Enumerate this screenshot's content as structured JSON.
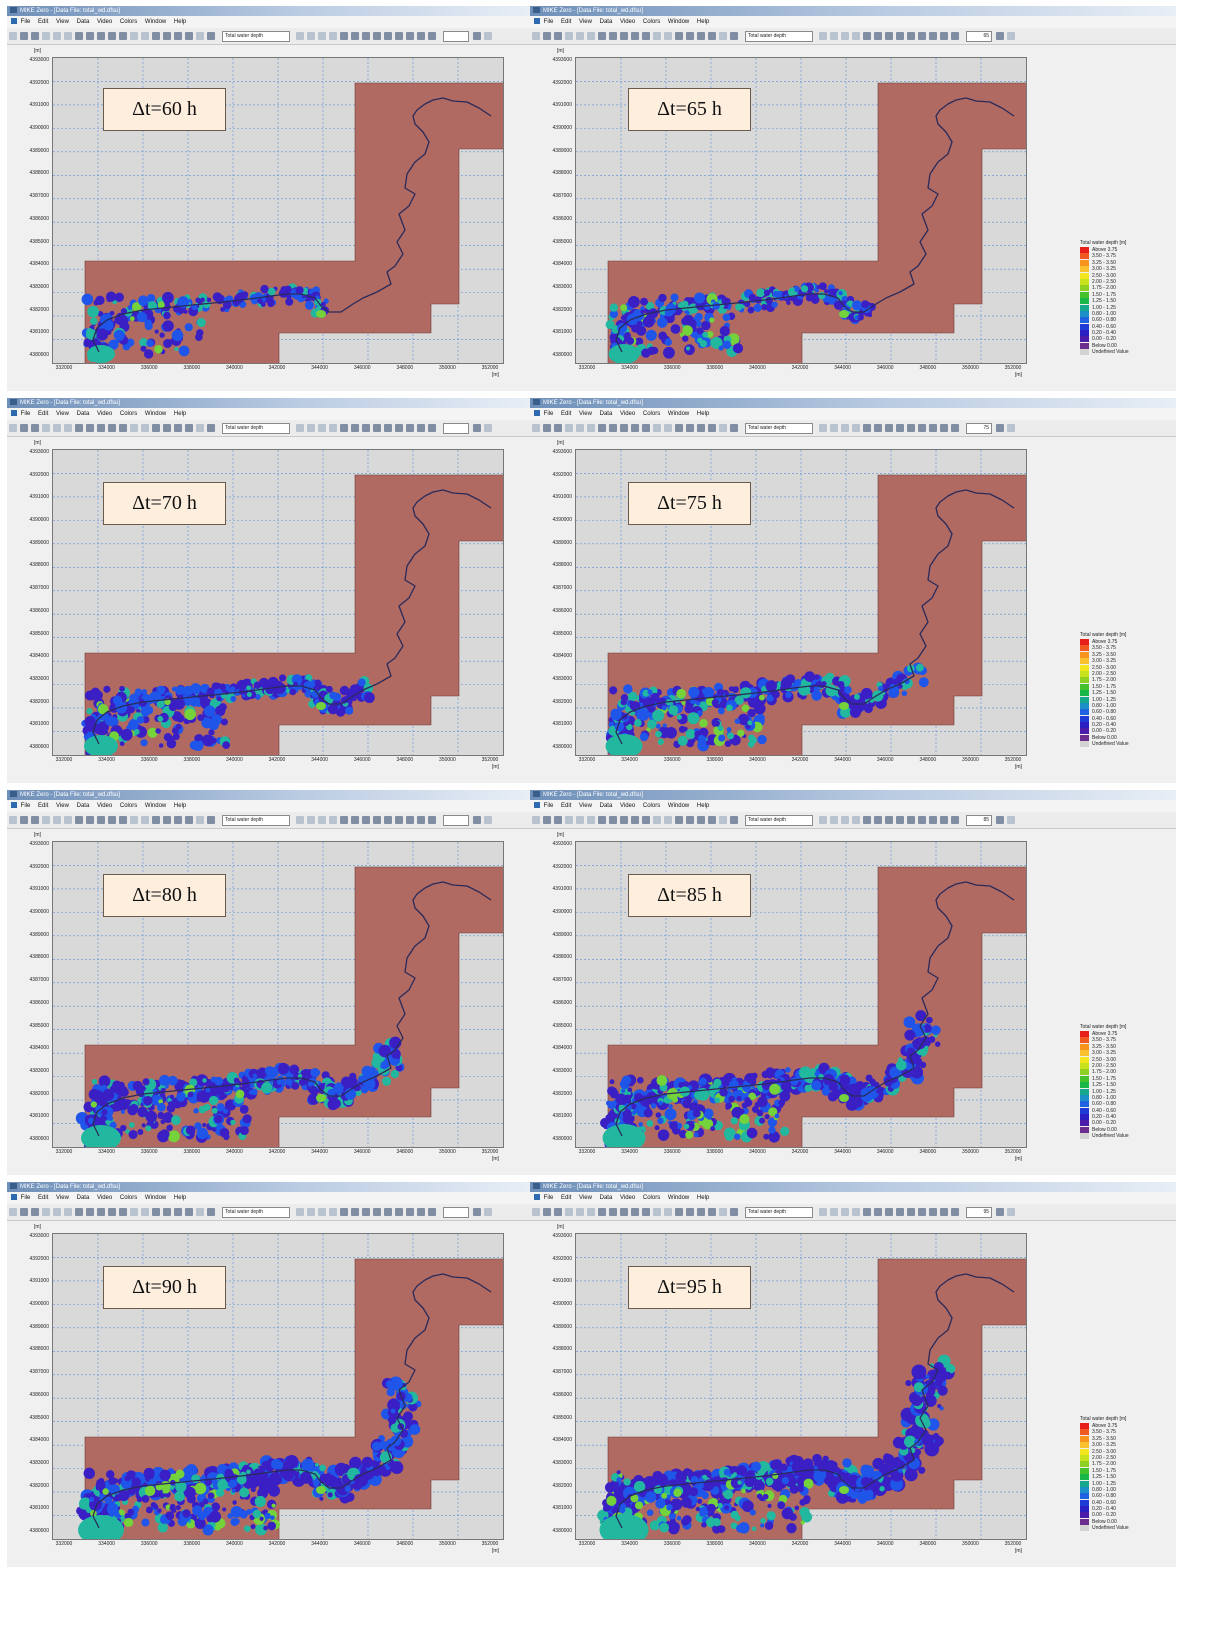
{
  "window": {
    "title": "MIKE Zero - [Data File: total_wd.dfsu]",
    "menu": [
      "File",
      "Edit",
      "View",
      "Data",
      "Video",
      "Colors",
      "Window",
      "Help"
    ],
    "item_combo": "Total water depth"
  },
  "panels": [
    {
      "label": "Δt=60 h",
      "time_step": "",
      "stage": 0,
      "legend": false
    },
    {
      "label": "Δt=65 h",
      "time_step": "65",
      "stage": 1,
      "legend": true
    },
    {
      "label": "Δt=70 h",
      "time_step": "",
      "stage": 2,
      "legend": false
    },
    {
      "label": "Δt=75 h",
      "time_step": "75",
      "stage": 3,
      "legend": true
    },
    {
      "label": "Δt=80 h",
      "time_step": "",
      "stage": 4,
      "legend": false
    },
    {
      "label": "Δt=85 h",
      "time_step": "85",
      "stage": 5,
      "legend": true
    },
    {
      "label": "Δt=90 h",
      "time_step": "",
      "stage": 6,
      "legend": false
    },
    {
      "label": "Δt=95 h",
      "time_step": "95",
      "stage": 7,
      "legend": true
    }
  ],
  "axes": {
    "unit": "[m]",
    "y_ticks": [
      "4393000",
      "4392000",
      "4391000",
      "4390000",
      "4389000",
      "4388000",
      "4387000",
      "4386000",
      "4385000",
      "4384000",
      "4383000",
      "4382000",
      "4381000",
      "4380000"
    ],
    "x_ticks": [
      "332000",
      "334000",
      "336000",
      "338000",
      "340000",
      "342000",
      "344000",
      "346000",
      "348000",
      "350000",
      "352000"
    ]
  },
  "legend": {
    "title": "Total water depth [m]",
    "items": [
      {
        "label": "Above 3.75",
        "color": "#e8201c"
      },
      {
        "label": "3.50 - 3.75",
        "color": "#f05a22"
      },
      {
        "label": "3.25 - 3.50",
        "color": "#f7941d"
      },
      {
        "label": "3.00 - 3.25",
        "color": "#fbc02d"
      },
      {
        "label": "2.50 - 3.00",
        "color": "#f4e61c"
      },
      {
        "label": "2.00 - 2.50",
        "color": "#c9e21e"
      },
      {
        "label": "1.75 - 2.00",
        "color": "#8fd123"
      },
      {
        "label": "1.50 - 1.75",
        "color": "#46c22c"
      },
      {
        "label": "1.25 - 1.50",
        "color": "#19b64a"
      },
      {
        "label": "1.00 - 1.25",
        "color": "#16a88c"
      },
      {
        "label": "0.80 - 1.00",
        "color": "#1c8fc7"
      },
      {
        "label": "0.60 - 0.80",
        "color": "#1f63e0"
      },
      {
        "label": "0.40 - 0.60",
        "color": "#1f3bd6"
      },
      {
        "label": "0.20 - 0.40",
        "color": "#2a1fc2"
      },
      {
        "label": "0.00 - 0.20",
        "color": "#4a1ca8"
      },
      {
        "label": "Below 0.00",
        "color": "#6b2d8e"
      },
      {
        "label": "Undefined Value",
        "color": "#d2d2d2"
      }
    ]
  },
  "colors": {
    "domain": "#b06a62",
    "background": "#d9d9d9",
    "grid": "#5b8fd8",
    "river": "#2a2a5a",
    "flood_dark": "#3a1fc4",
    "flood_mid": "#1f55e8",
    "flood_light": "#22b8a0",
    "flood_green": "#74d33a"
  }
}
